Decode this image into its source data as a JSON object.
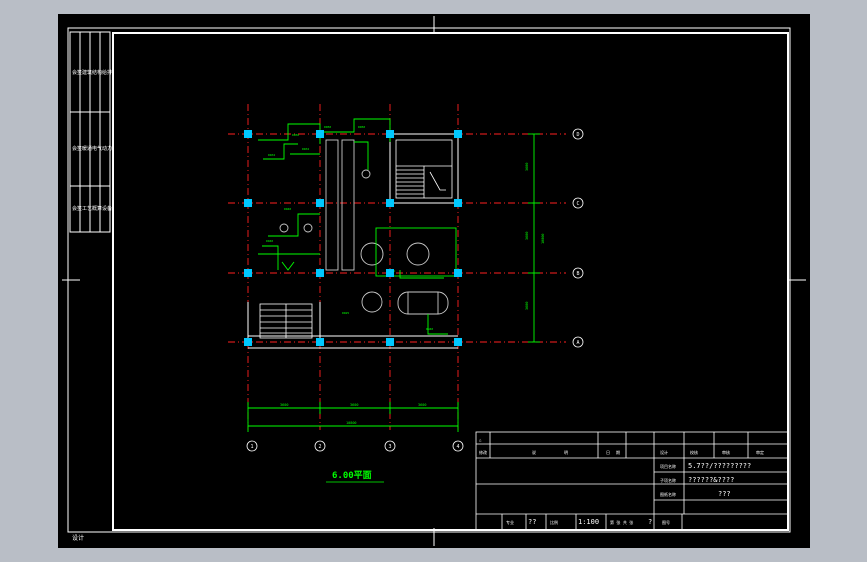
{
  "colors": {
    "background": "#000000",
    "frame": "#ffffff",
    "axis": "#ff2020",
    "wall": "#ffffff",
    "pipe": "#00ff00",
    "column": "#00c8ff",
    "equipment": "#c8c8c8",
    "window_chrome": "#b9bec6"
  },
  "axes": {
    "horizontal": [
      "1",
      "2",
      "3",
      "4"
    ],
    "vertical": [
      "D",
      "C",
      "B",
      "A"
    ]
  },
  "dimensions": {
    "bottom_segments": [
      "3600",
      "3600",
      "3600"
    ],
    "bottom_total": "10800",
    "right_segments": [
      "3600",
      "3600",
      "3600"
    ],
    "right_total": "10800"
  },
  "plan_title": "6.00平面",
  "title_block": {
    "revision_mark": "△",
    "header_labels": [
      "修改",
      "说",
      "明",
      "日",
      "期",
      "设计",
      "校核",
      "审核",
      "审定"
    ],
    "project_label": "项目名称",
    "project_value": "5.7??/?????????",
    "subproject_label": "子项名称",
    "subproject_value": "??????&????",
    "drawing_label": "图纸名称",
    "drawing_value": "???",
    "scale_label": "比例",
    "scale_value": "1:100",
    "sheet_label": "第 张  共 张",
    "sheet_value": "?",
    "design_label": "专业",
    "design_value": "??",
    "drawing_no_label": "图号"
  },
  "corner_text": "设计"
}
